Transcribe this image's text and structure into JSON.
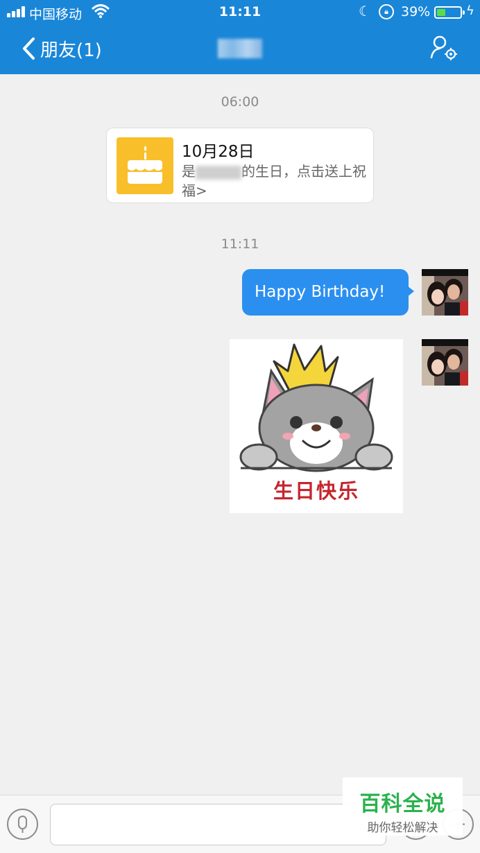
{
  "status_bar": {
    "carrier": "中国移动",
    "time": "11:11",
    "battery": "39%",
    "battery_level": 0.39
  },
  "nav": {
    "back_label": "朋友(1)",
    "title": ""
  },
  "messages": {
    "timestamp_1": "06:00",
    "birthday": {
      "date": "10月28日",
      "text_prefix": "是",
      "text_suffix": "的生日，点击送上祝福>"
    },
    "timestamp_2": "11:11",
    "text_message": "Happy Birthday!",
    "sticker_text": "生日快乐"
  },
  "input": {
    "placeholder": ""
  },
  "watermark": {
    "title": "百科全说",
    "subtitle": "助你轻松解决"
  },
  "colors": {
    "header": "#1a86d8",
    "bubble": "#2b8ff0",
    "cake": "#f8bf2a",
    "watermark": "#2bb24c"
  }
}
